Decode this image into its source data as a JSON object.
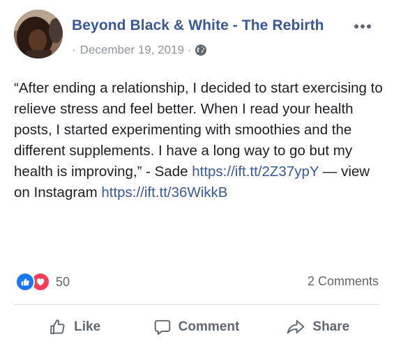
{
  "header": {
    "page_name": "Beyond Black & White - The Rebirth",
    "date": "December 19, 2019",
    "dot_separator": "·",
    "privacy_icon": "globe-icon",
    "more_icon": "more-options-icon"
  },
  "post": {
    "text": "“After ending a relationship, I decided to start exercising to relieve stress and feel better. When I read your health posts, I started experimenting with smoothies and the different supplements. I have a long way to go but my health is improving,” - Sade ",
    "link1": "https://ift.tt/2Z37ypY",
    "middle_text": " — view on Instagram ",
    "link2": "https://ift.tt/36WikkB"
  },
  "stats": {
    "reaction_icons": [
      "like-reaction-icon",
      "love-reaction-icon"
    ],
    "reaction_count": "50",
    "comments_label": "2 Comments"
  },
  "actions": {
    "like_label": "Like",
    "comment_label": "Comment",
    "share_label": "Share"
  },
  "colors": {
    "brand_link": "#385898",
    "muted": "#606770",
    "like_blue": "#1877f2",
    "love_red": "#f33e58"
  }
}
